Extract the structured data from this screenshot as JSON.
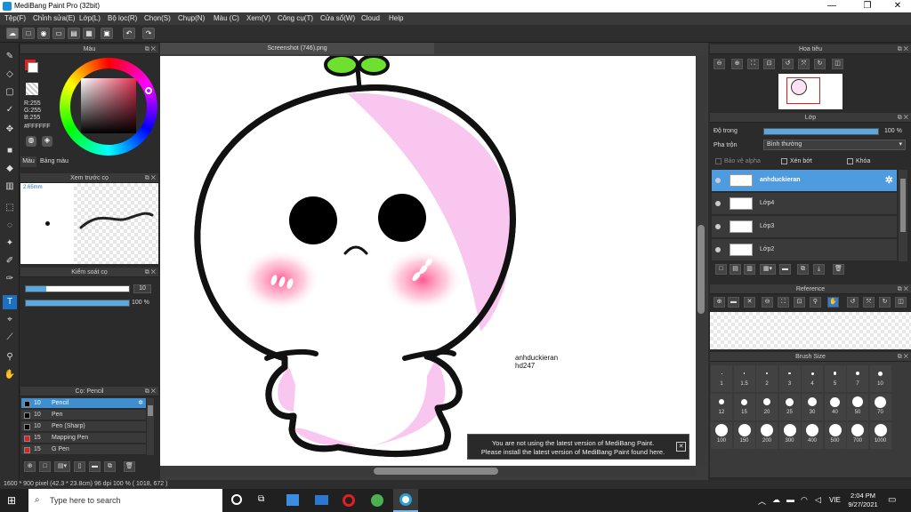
{
  "window": {
    "title": "MediBang Paint Pro (32bit)",
    "minimize": "—",
    "maximize": "❐",
    "close": "✕"
  },
  "menu": [
    "Tệp(F)",
    "Chỉnh sửa(E)",
    "Lớp(L)",
    "Bộ lọc(R)",
    "Chọn(S)",
    "Chụp(N)",
    "Màu (C)",
    "Xem(V)",
    "Công cụ(T)",
    "Cửa sổ(W)",
    "Cloud",
    "Help"
  ],
  "color_panel": {
    "title": "Màu",
    "rgb": [
      "R:255",
      "G:255",
      "B:255"
    ],
    "hex": "#FFFFFF",
    "tabs": [
      "Màu",
      "Bảng màu"
    ],
    "primary_color": "#ffffff",
    "secondary_color": "#e02020"
  },
  "preview_panel": {
    "title": "Xem trước cọ",
    "size": "2.65mm"
  },
  "brush_control": {
    "title": "Kiểm soát cọ",
    "size_value": "10",
    "opacity_value": "100 %",
    "size_fraction": 0.1,
    "opacity_fraction": 1.0
  },
  "brush_list": {
    "title": "Cọ: Pencil",
    "items": [
      {
        "num": "10",
        "name": "Pencil",
        "color": "#111111",
        "selected": true
      },
      {
        "num": "10",
        "name": "Pen",
        "color": "#111111",
        "selected": false
      },
      {
        "num": "10",
        "name": "Pen (Sharp)",
        "color": "#111111",
        "selected": false
      },
      {
        "num": "15",
        "name": "Mapping Pen",
        "color": "#e02020",
        "selected": false
      },
      {
        "num": "15",
        "name": "G Pen",
        "color": "#e02020",
        "selected": false
      }
    ]
  },
  "document": {
    "tab": "Screenshot (746).png",
    "signature_line1": "anhduckieran",
    "signature_line2": "hd247"
  },
  "navigator": {
    "title": "Hoa tiêu"
  },
  "layer_panel": {
    "title": "Lớp",
    "opacity_label": "Độ trong",
    "opacity_value": "100 %",
    "opacity_fraction": 1.0,
    "blend_label": "Pha trộn",
    "blend_value": "Bình thường",
    "options": [
      "Bảo vệ alpha",
      "Xén bớt",
      "Khóa"
    ],
    "layers": [
      {
        "name": "anhduckieran",
        "selected": true
      },
      {
        "name": "Lớp4",
        "selected": false
      },
      {
        "name": "Lớp3",
        "selected": false
      },
      {
        "name": "Lớp2",
        "selected": false
      }
    ]
  },
  "reference_panel": {
    "title": "Reference"
  },
  "brush_size_panel": {
    "title": "Brush Size",
    "sizes": [
      "1",
      "1.5",
      "2",
      "3",
      "4",
      "5",
      "7",
      "10",
      "12",
      "15",
      "20",
      "25",
      "30",
      "40",
      "50",
      "70",
      "100",
      "150",
      "200",
      "300",
      "400",
      "500",
      "700",
      "1000"
    ]
  },
  "notice": {
    "line1": "You are not using the latest version of MediBang Paint.",
    "line2": "Please install the latest version of MediBang Paint found here.",
    "close": "✕"
  },
  "status": "1600 * 900 pixel   (42.3 * 23.8cm)  96 dpi  100 %  ( 1018, 672 )",
  "taskbar": {
    "search_placeholder": "Type here to search",
    "time": "2:04 PM",
    "date": "9/27/2021",
    "lang": "VIE"
  }
}
